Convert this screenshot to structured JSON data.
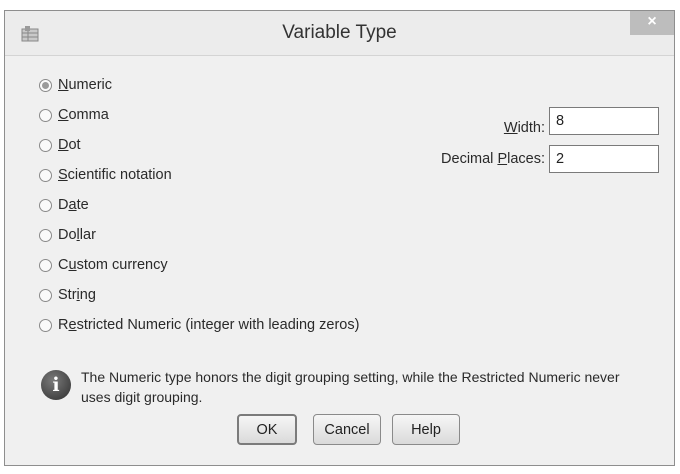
{
  "window": {
    "title": "Variable Type",
    "close_glyph": "×"
  },
  "types": [
    {
      "pre": "",
      "key": "N",
      "post": "umeric",
      "selected": true
    },
    {
      "pre": "",
      "key": "C",
      "post": "omma",
      "selected": false
    },
    {
      "pre": "",
      "key": "D",
      "post": "ot",
      "selected": false
    },
    {
      "pre": "",
      "key": "S",
      "post": "cientific notation",
      "selected": false
    },
    {
      "pre": "D",
      "key": "a",
      "post": "te",
      "selected": false
    },
    {
      "pre": "Do",
      "key": "l",
      "post": "lar",
      "selected": false
    },
    {
      "pre": "C",
      "key": "u",
      "post": "stom currency",
      "selected": false
    },
    {
      "pre": "Str",
      "key": "i",
      "post": "ng",
      "selected": false
    },
    {
      "pre": "R",
      "key": "e",
      "post": "stricted Numeric (integer with leading zeros)",
      "selected": false
    }
  ],
  "width": {
    "label_pre": "",
    "label_key": "W",
    "label_post": "idth:",
    "value": "8"
  },
  "decimals": {
    "label_pre": "Decimal ",
    "label_key": "P",
    "label_post": "laces:",
    "value": "2"
  },
  "info": {
    "icon": "i",
    "text": "The Numeric type honors the digit grouping setting, while the Restricted Numeric never uses digit grouping."
  },
  "buttons": {
    "ok": "OK",
    "cancel": "Cancel",
    "help": "Help"
  },
  "icons": {
    "app": "spss-data-icon",
    "info": "info-icon",
    "close": "close-icon"
  }
}
